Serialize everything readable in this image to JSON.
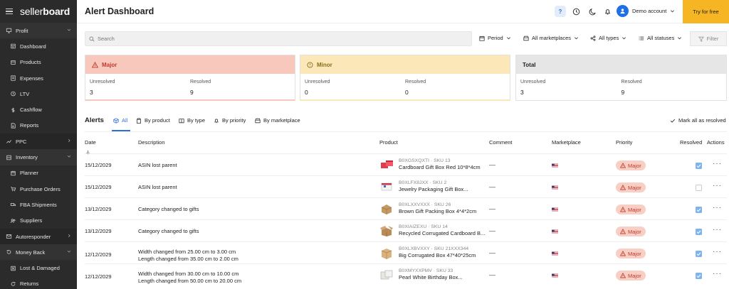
{
  "app": {
    "logo_light": "seller",
    "logo_bold": "board"
  },
  "sidebar": {
    "items": [
      {
        "label": "Profit",
        "type": "section",
        "icon": "monitor-icon",
        "chevron": "down"
      },
      {
        "label": "Dashboard",
        "type": "sub",
        "icon": "dashboard-icon"
      },
      {
        "label": "Products",
        "type": "sub",
        "icon": "products-icon"
      },
      {
        "label": "Expenses",
        "type": "sub",
        "icon": "expenses-icon"
      },
      {
        "label": "LTV",
        "type": "sub",
        "icon": "ltv-icon"
      },
      {
        "label": "Cashflow",
        "type": "sub",
        "icon": "cashflow-icon"
      },
      {
        "label": "Reports",
        "type": "sub",
        "icon": "reports-icon"
      },
      {
        "label": "PPC",
        "type": "section",
        "icon": "ppc-icon",
        "chevron": "right"
      },
      {
        "label": "Inventory",
        "type": "section",
        "icon": "inventory-icon",
        "chevron": "down"
      },
      {
        "label": "Planner",
        "type": "sub",
        "icon": "planner-icon"
      },
      {
        "label": "Purchase Orders",
        "type": "sub",
        "icon": "purchase-orders-icon"
      },
      {
        "label": "FBA Shipments",
        "type": "sub",
        "icon": "fba-shipments-icon"
      },
      {
        "label": "Suppliers",
        "type": "sub",
        "icon": "suppliers-icon"
      },
      {
        "label": "Autoresponder",
        "type": "section",
        "icon": "autoresponder-icon",
        "chevron": "right"
      },
      {
        "label": "Money Back",
        "type": "section",
        "icon": "money-back-icon",
        "chevron": "down"
      },
      {
        "label": "Lost & Damaged",
        "type": "sub",
        "icon": "lost-damaged-icon"
      },
      {
        "label": "Returns",
        "type": "sub",
        "icon": "returns-icon"
      }
    ]
  },
  "header": {
    "title": "Alert Dashboard",
    "help_label": "?",
    "account_label": "Demo account",
    "try_label": "Try for free"
  },
  "filters": {
    "search_placeholder": "Search",
    "period": "Period",
    "marketplaces": "All marketplaces",
    "types": "All types",
    "statuses": "All statuses",
    "filter_label": "Filter"
  },
  "summary": {
    "major": {
      "title": "Major",
      "unresolved_label": "Unresolved",
      "unresolved": "3",
      "resolved_label": "Resolved",
      "resolved": "9"
    },
    "minor": {
      "title": "Minor",
      "unresolved_label": "Unresolved",
      "unresolved": "0",
      "resolved_label": "Resolved",
      "resolved": "0"
    },
    "total": {
      "title": "Total",
      "unresolved_label": "Unresolved",
      "unresolved": "3",
      "resolved_label": "Resolved",
      "resolved": "9"
    }
  },
  "alerts": {
    "title": "Alerts",
    "tabs": {
      "all": "All",
      "product": "By product",
      "type": "By type",
      "priority": "By priority",
      "marketplace": "By marketplace"
    },
    "mark_all": "Mark all as resolved",
    "columns": {
      "date": "Date",
      "description": "Description",
      "product": "Product",
      "comment": "Comment",
      "marketplace": "Marketplace",
      "priority": "Priority",
      "resolved": "Resolved",
      "actions": "Actions"
    },
    "rows": [
      {
        "date": "15/12/2029",
        "desc1": "ASIN lost parent",
        "desc2": "",
        "sku": "B0XGSXQXTI · SKU 13",
        "product": "Cardboard Gift Box Red 10*8*4cm",
        "comment": "—",
        "priority": "Major",
        "resolved": true,
        "thumb": "red"
      },
      {
        "date": "15/12/2029",
        "desc1": "ASIN lost parent",
        "desc2": "",
        "sku": "B0XLFX8JXX · SKU 2",
        "product": "Jewelry Packaging Gift Box...",
        "comment": "—",
        "priority": "Major",
        "resolved": false,
        "thumb": "white"
      },
      {
        "date": "13/12/2029",
        "desc1": "Category changed to gifts",
        "desc2": "",
        "sku": "B0XLXXVXXX · SKU 26",
        "product": "Brown Gift Packing Box 4*4*2cm",
        "comment": "—",
        "priority": "Major",
        "resolved": true,
        "thumb": "brown"
      },
      {
        "date": "13/12/2029",
        "desc1": "Category changed to gifts",
        "desc2": "",
        "sku": "B0XIAIZEXU · SKU 14",
        "product": "Recycled Corrugated Cardboard B...",
        "comment": "—",
        "priority": "Major",
        "resolved": true,
        "thumb": "open"
      },
      {
        "date": "12/12/2029",
        "desc1": "Width changed from 25.00 cm to 3.00 cm",
        "desc2": "Length changed from 35.00 cm to 2.00 cm",
        "sku": "B0XLXBVXXY · SKU 21XXX344",
        "product": "Big Corrugated Box 47*40*25cm",
        "comment": "—",
        "priority": "Major",
        "resolved": true,
        "thumb": "big"
      },
      {
        "date": "12/12/2029",
        "desc1": "Width changed from 30.00 cm to 10.00 cm",
        "desc2": "Length changed from 50.00 cm to 20.00 cm",
        "sku": "B0XMYXXPMV · SKU 33",
        "product": "Pearl White Birthday Box...",
        "comment": "—",
        "priority": "Major",
        "resolved": true,
        "thumb": "pearl"
      }
    ]
  },
  "colors": {
    "accent": "#2d6fdb",
    "major": "#f8c8bd",
    "minor": "#fbe7b8",
    "try": "#f6b522"
  }
}
